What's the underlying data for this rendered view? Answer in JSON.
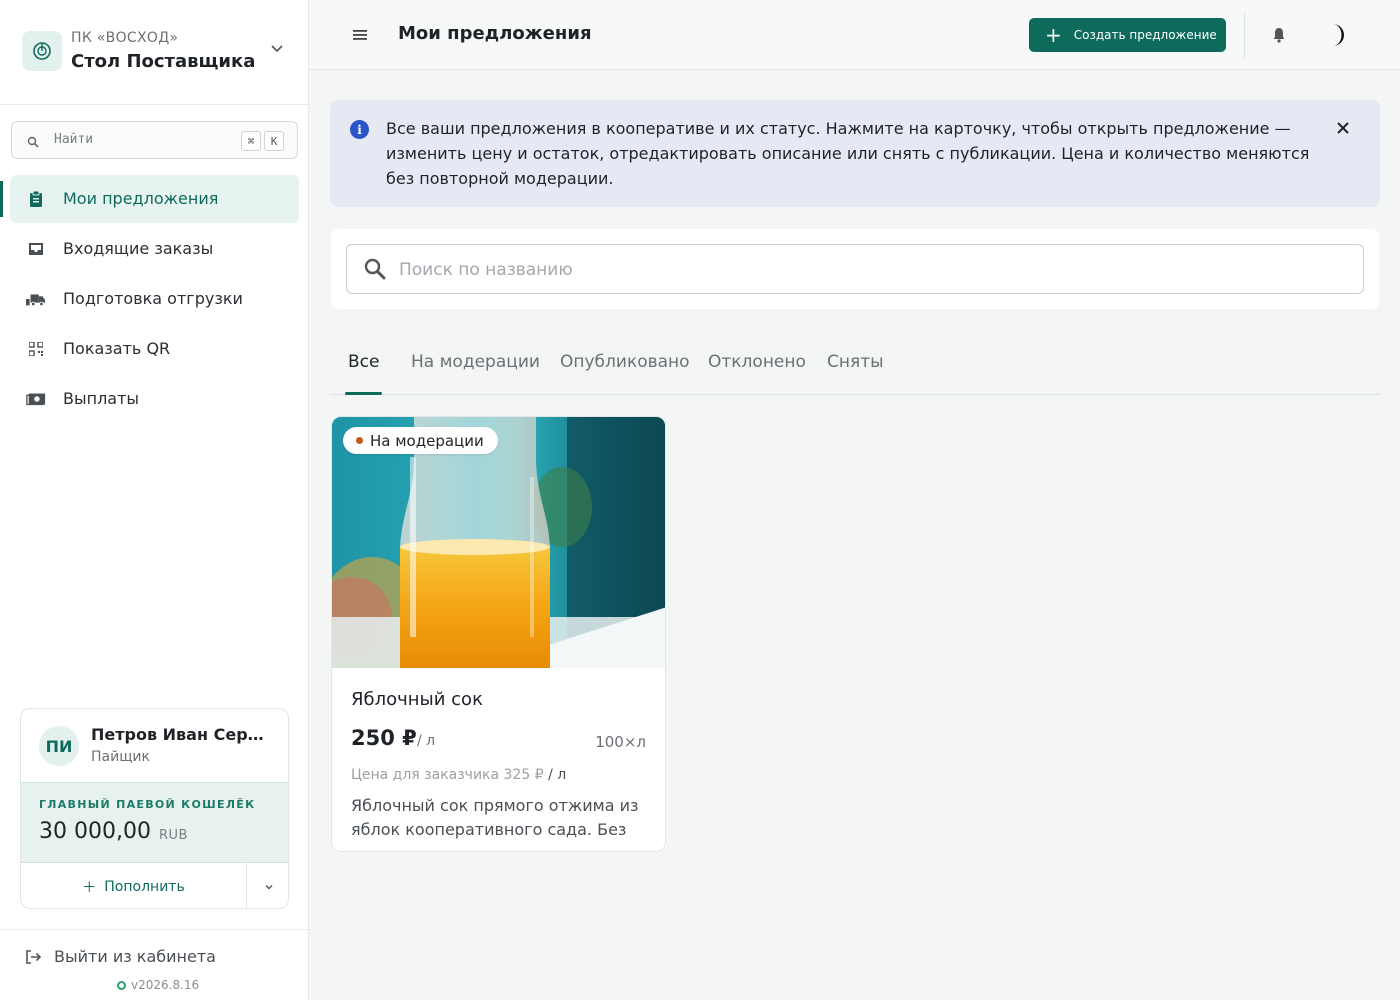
{
  "org": {
    "subtitle": "ПК «ВОСХОД»",
    "title": "Стол Поставщика"
  },
  "search": {
    "placeholder": "Найти",
    "kbd1": "⌘",
    "kbd2": "K"
  },
  "nav": [
    {
      "label": "Мои предложения",
      "icon": "clipboard-icon",
      "active": true
    },
    {
      "label": "Входящие заказы",
      "icon": "inbox-icon",
      "active": false
    },
    {
      "label": "Подготовка отгрузки",
      "icon": "truck-icon",
      "active": false
    },
    {
      "label": "Показать QR",
      "icon": "qr-code-icon",
      "active": false
    },
    {
      "label": "Выплаты",
      "icon": "money-icon",
      "active": false
    }
  ],
  "user": {
    "initials": "ПИ",
    "name": "Петров Иван Сергеевич",
    "role": "Пайщик",
    "wallet_label": "ГЛАВНЫЙ ПАЕВОЙ КОШЕЛЁК",
    "wallet_amount": "30 000,00",
    "wallet_currency": "RUB",
    "topup_label": "Пополнить"
  },
  "logout": {
    "label": "Выйти из кабинета"
  },
  "version": "v2026.8.16",
  "header": {
    "title": "Мои предложения",
    "create_label": "Создать предложение"
  },
  "info": {
    "text": "Все ваши предложения в кооперативе и их статус. Нажмите на карточку, чтобы открыть предложение — изменить цену и остаток, отредактировать описание или снять с публикации. Цена и количество меняются без повторной модерации."
  },
  "search_main": {
    "placeholder": "Поиск по названию"
  },
  "tabs": [
    {
      "label": "Все",
      "active": true
    },
    {
      "label": "На модерации",
      "active": false
    },
    {
      "label": "Опубликовано",
      "active": false
    },
    {
      "label": "Отклонено",
      "active": false
    },
    {
      "label": "Сняты",
      "active": false
    }
  ],
  "offers": [
    {
      "status": "На модерации",
      "title": "Яблочный сок",
      "price": "250 ₽",
      "unit": "/ л",
      "stock": "100×л",
      "client_price_prefix": "Цена для заказчика 325 ₽",
      "client_price_unit": "/ л",
      "description": "Яблочный сок прямого отжима из яблок кооперативного сада. Без сахара и консервантов."
    }
  ],
  "colors": {
    "accent": "#0e6b5c",
    "info_bg": "#e6e9f4",
    "status_moderation": "#c4581a"
  }
}
